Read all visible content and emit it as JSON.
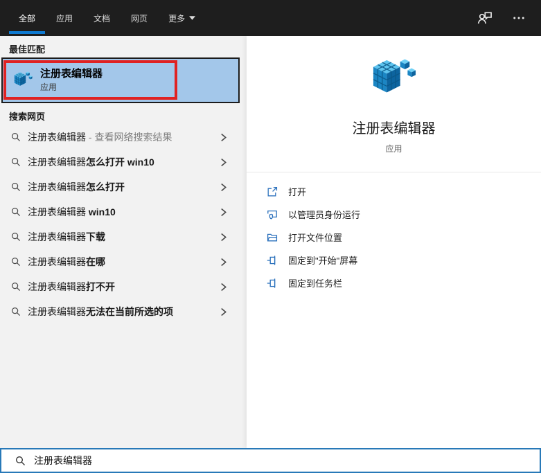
{
  "topbar": {
    "tabs": [
      {
        "label": "全部",
        "selected": true
      },
      {
        "label": "应用",
        "selected": false
      },
      {
        "label": "文档",
        "selected": false
      },
      {
        "label": "网页",
        "selected": false
      }
    ],
    "more": {
      "label": "更多",
      "icon": "chevron-down-icon"
    },
    "right_icons": [
      "user-account-icon",
      "more-options-icon"
    ]
  },
  "best_match": {
    "header": "最佳匹配",
    "title": "注册表编辑器",
    "subtitle": "应用",
    "icon": "registry-editor-icon"
  },
  "search_web": {
    "header": "搜索网页",
    "row_icon": "search-icon",
    "row_chevron": "chevron-right-icon",
    "rows": [
      {
        "query": "注册表编辑器",
        "completion": "",
        "suffix": " - 查看网络搜索结果"
      },
      {
        "query": "注册表编辑器",
        "completion": "怎么打开 win10",
        "suffix": ""
      },
      {
        "query": "注册表编辑器",
        "completion": "怎么打开",
        "suffix": ""
      },
      {
        "query": "注册表编辑器",
        "completion": " win10",
        "suffix": ""
      },
      {
        "query": "注册表编辑器",
        "completion": "下载",
        "suffix": ""
      },
      {
        "query": "注册表编辑器",
        "completion": "在哪",
        "suffix": ""
      },
      {
        "query": "注册表编辑器",
        "completion": "打不开",
        "suffix": ""
      },
      {
        "query": "注册表编辑器",
        "completion": "无法在当前所选的项",
        "suffix": ""
      }
    ]
  },
  "preview": {
    "title": "注册表编辑器",
    "subtitle": "应用",
    "icon": "registry-editor-icon",
    "actions": [
      {
        "icon": "open-icon",
        "label": "打开"
      },
      {
        "icon": "run-as-admin-icon",
        "label": "以管理员身份运行"
      },
      {
        "icon": "open-file-location-icon",
        "label": "打开文件位置"
      },
      {
        "icon": "pin-to-start-icon",
        "label": "固定到\"开始\"屏幕"
      },
      {
        "icon": "pin-to-taskbar-icon",
        "label": "固定到任务栏"
      }
    ]
  },
  "search_bar": {
    "icon": "search-icon",
    "value": "注册表编辑器"
  },
  "colors": {
    "accent_underline": "#0f7ad1",
    "selected_item_bg": "#a3c7ea",
    "annotation_red": "#e02222",
    "action_icon_blue": "#2d72bd",
    "topbar_bg": "#1e1e1e",
    "search_border_blue": "#2879b8"
  }
}
